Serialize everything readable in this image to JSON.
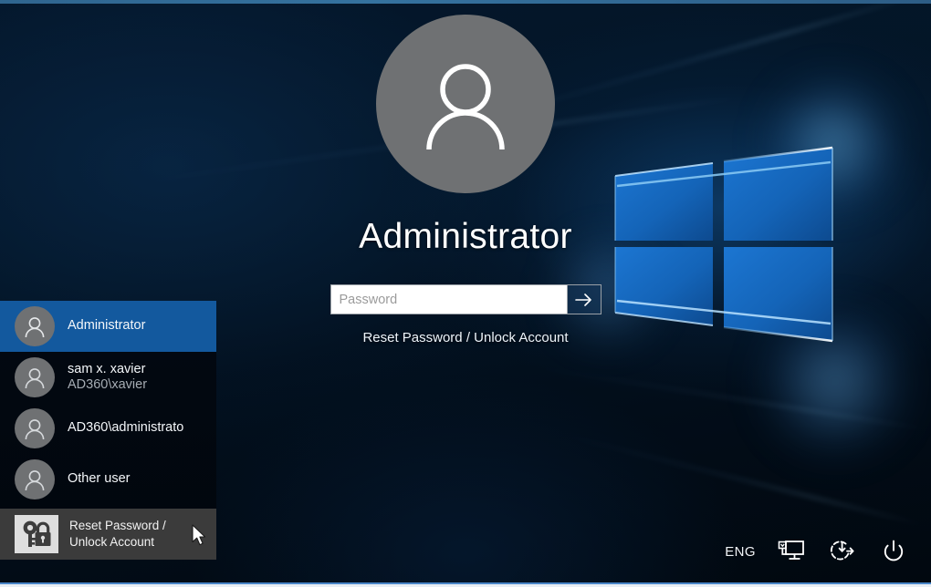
{
  "screen": {
    "kind": "windows-lock-screen",
    "accent_selected": "#13599e",
    "tool_tile_bg": "#3b3b3b",
    "avatar_bg": "#6f7173",
    "background_desc": "Windows 10 dark blue hero wallpaper"
  },
  "user_panel": {
    "avatar_icon": "person-icon",
    "display_name": "Administrator",
    "password": {
      "placeholder": "Password",
      "value": "",
      "submit_icon": "arrow-right-icon"
    },
    "reset_link": "Reset Password / Unlock Account"
  },
  "user_list": {
    "items": [
      {
        "icon": "person-icon",
        "primary": "Administrator",
        "secondary": "",
        "selected": true,
        "kind": "user"
      },
      {
        "icon": "person-icon",
        "primary": "sam x. xavier",
        "secondary": "AD360\\xavier",
        "selected": false,
        "kind": "user"
      },
      {
        "icon": "person-icon",
        "primary": "AD360\\administrato",
        "secondary": "",
        "selected": false,
        "kind": "user"
      },
      {
        "icon": "person-icon",
        "primary": "Other user",
        "secondary": "",
        "selected": false,
        "kind": "user"
      }
    ],
    "tool_tile": {
      "icon": "key-lock-icon",
      "line1": "Reset Password /",
      "line2": "Unlock Account"
    }
  },
  "tray": {
    "language": "ENG",
    "buttons": [
      {
        "icon": "ease-of-access-icon",
        "label": "Ease of Access"
      },
      {
        "icon": "network-icon",
        "label": "Network"
      },
      {
        "icon": "power-icon",
        "label": "Power"
      }
    ]
  },
  "cursor": {
    "icon": "mouse-pointer-icon"
  }
}
